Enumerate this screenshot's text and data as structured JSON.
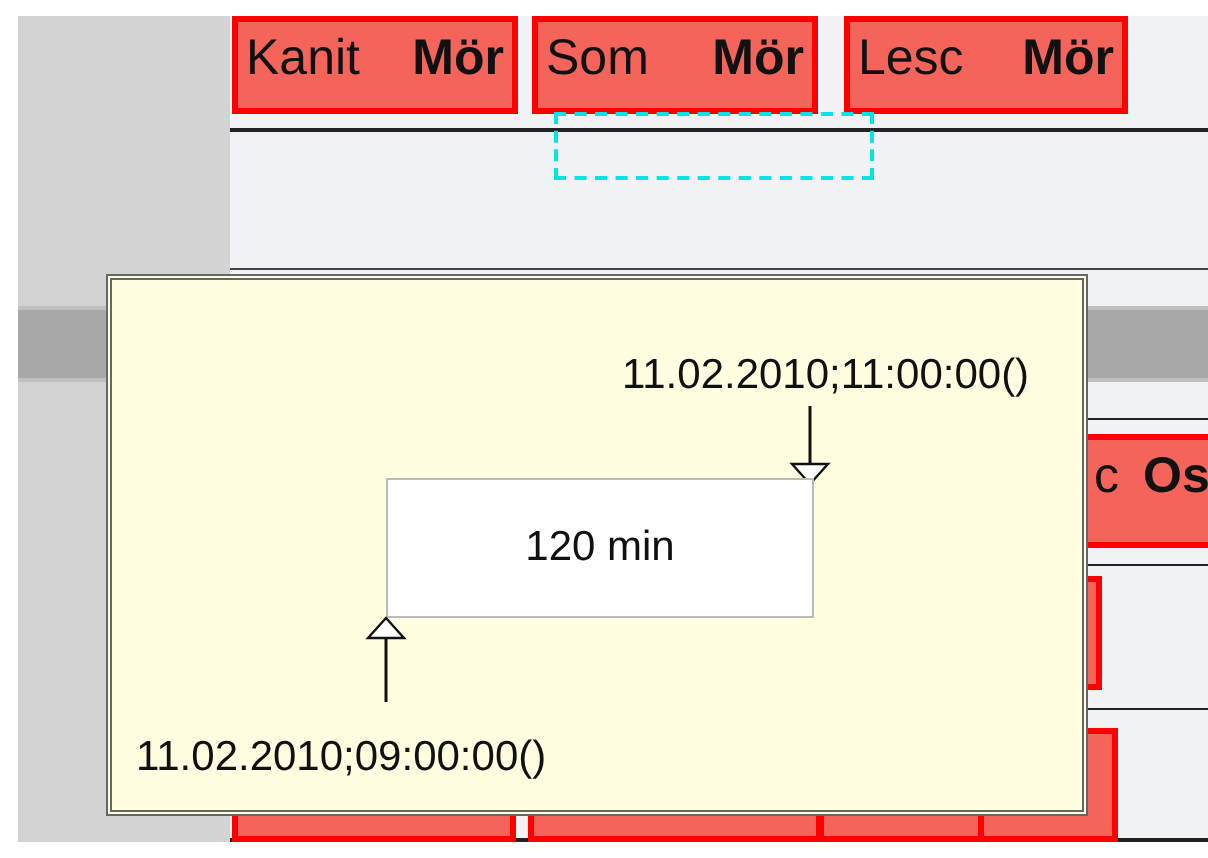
{
  "appointments": [
    {
      "kind": "full",
      "title": "Kanit",
      "subtitle": "Mör"
    },
    {
      "kind": "full",
      "title": "Som",
      "subtitle": "Mör"
    },
    {
      "kind": "full",
      "title": "Lesc",
      "subtitle": "Mör"
    },
    {
      "kind": "partial",
      "title": "c",
      "subtitle": "Os"
    },
    {
      "kind": "blank"
    },
    {
      "kind": "blank"
    },
    {
      "kind": "blank"
    },
    {
      "kind": "blank"
    },
    {
      "kind": "blank"
    }
  ],
  "tooltip": {
    "end_time": "11.02.2010;11:00:00()",
    "duration": "120 min",
    "start_time": "11.02.2010;09:00:00()"
  }
}
